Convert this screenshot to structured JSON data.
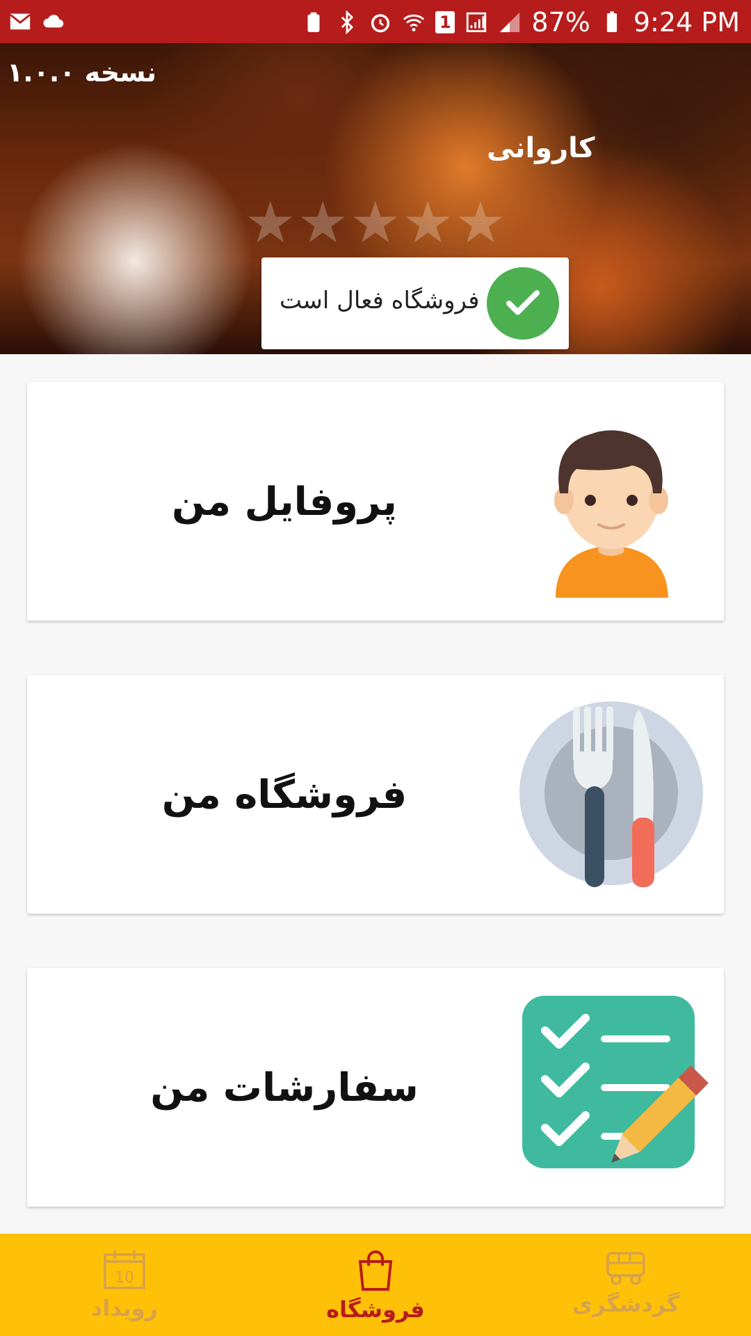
{
  "status_bar": {
    "battery": "87%",
    "time": "9:24 PM",
    "sim_slot": "1"
  },
  "header": {
    "version": "نسخه ۱.۰.۰",
    "shop_name": "کاروانی",
    "rating_stars": 0,
    "status_text": "فروشگاه فعال است"
  },
  "cards": [
    {
      "title": "پروفایل من",
      "icon": "profile-avatar-icon"
    },
    {
      "title": "فروشگاه من",
      "icon": "plate-fork-knife-icon"
    },
    {
      "title": "سفارشات من",
      "icon": "checklist-pencil-icon"
    }
  ],
  "bottom_nav": {
    "items": [
      {
        "label": "رویداد",
        "icon": "calendar-icon",
        "badge": "10"
      },
      {
        "label": "فروشگاه",
        "icon": "shopping-bag-icon"
      },
      {
        "label": "گردشگری",
        "icon": "bus-icon"
      }
    ],
    "active_index": 1
  },
  "colors": {
    "status_bar": "#b71c1c",
    "bottom_nav": "#ffc107",
    "active": "#b71c1c",
    "inactive": "#d6a24a",
    "success": "#4caf50"
  }
}
